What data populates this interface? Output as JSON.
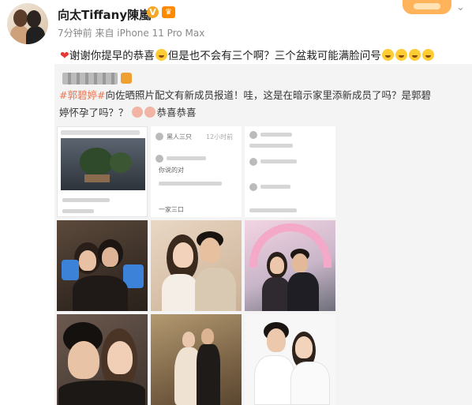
{
  "post": {
    "username": "向太Tiffany陳嵐",
    "verified_badge": "V",
    "member_badge": "♛",
    "meta": "7分钟前 来自 iPhone 11 Pro Max",
    "text_part1": "谢谢你提早的恭喜",
    "text_part2": "但是也不会有三个啊？三个盆栽可能满脸问号",
    "heart_icon": "❤"
  },
  "repost": {
    "hashtag": "#郭碧婷#",
    "text1": "向佐晒照片配文有新成员报道！哇，这是在暗示家里添新成员了吗？是郭碧",
    "text2_a": "婷怀孕了吗？？",
    "text2_b": "恭喜恭喜"
  },
  "screenshots": {
    "s2_labels": [
      "黑人三只",
      "你说的对",
      "一家三口"
    ],
    "s2_count": "12小时前",
    "s3_labels": []
  },
  "colors": {
    "hashtag": "#eb7350",
    "verified": "#f5a623",
    "heart": "#e53935"
  }
}
